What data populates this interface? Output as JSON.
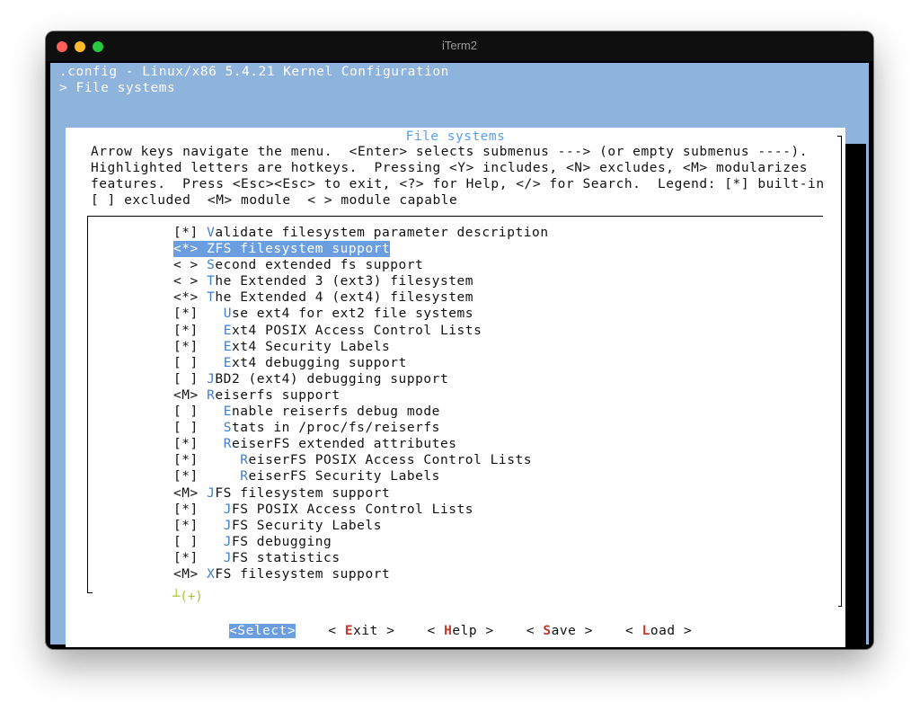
{
  "window": {
    "title": "iTerm2"
  },
  "header": {
    "config_line": ".config - Linux/x86 5.4.21 Kernel Configuration",
    "breadcrumb": "> File systems"
  },
  "dialog": {
    "title": "File systems",
    "help_lines": [
      "Arrow keys navigate the menu.  <Enter> selects submenus ---> (or empty submenus ----).",
      "Highlighted letters are hotkeys.  Pressing <Y> includes, <N> excludes, <M> modularizes",
      "features.  Press <Esc><Esc> to exit, <?> for Help, </> for Search.  Legend: [*] built-in",
      "[ ] excluded  <M> module  < > module capable"
    ],
    "more_indicator": "┴(+)"
  },
  "menu": {
    "items": [
      {
        "state": "[*]",
        "indent": " ",
        "hotkey": "V",
        "rest": "alidate filesystem parameter description"
      },
      {
        "state": "<*>",
        "indent": " ",
        "hotkey": "Z",
        "rest": "FS filesystem support",
        "selected": true
      },
      {
        "state": "< >",
        "indent": " ",
        "hotkey": "S",
        "rest": "econd extended fs support"
      },
      {
        "state": "< >",
        "indent": " ",
        "hotkey": "T",
        "rest": "he Extended 3 (ext3) filesystem"
      },
      {
        "state": "<*>",
        "indent": " ",
        "hotkey": "T",
        "rest": "he Extended 4 (ext4) filesystem"
      },
      {
        "state": "[*]",
        "indent": "   ",
        "hotkey": "U",
        "rest": "se ext4 for ext2 file systems"
      },
      {
        "state": "[*]",
        "indent": "   ",
        "hotkey": "E",
        "rest": "xt4 POSIX Access Control Lists"
      },
      {
        "state": "[*]",
        "indent": "   ",
        "hotkey": "E",
        "rest": "xt4 Security Labels"
      },
      {
        "state": "[ ]",
        "indent": "   ",
        "hotkey": "E",
        "rest": "xt4 debugging support"
      },
      {
        "state": "[ ]",
        "indent": " ",
        "hotkey": "J",
        "rest": "BD2 (ext4) debugging support"
      },
      {
        "state": "<M>",
        "indent": " ",
        "hotkey": "R",
        "rest": "eiserfs support"
      },
      {
        "state": "[ ]",
        "indent": "   ",
        "hotkey": "E",
        "rest": "nable reiserfs debug mode"
      },
      {
        "state": "[ ]",
        "indent": "   ",
        "hotkey": "S",
        "rest": "tats in /proc/fs/reiserfs"
      },
      {
        "state": "[*]",
        "indent": "   ",
        "hotkey": "R",
        "rest": "eiserFS extended attributes"
      },
      {
        "state": "[*]",
        "indent": "     ",
        "hotkey": "R",
        "rest": "eiserFS POSIX Access Control Lists"
      },
      {
        "state": "[*]",
        "indent": "     ",
        "hotkey": "R",
        "rest": "eiserFS Security Labels"
      },
      {
        "state": "<M>",
        "indent": " ",
        "hotkey": "J",
        "rest": "FS filesystem support"
      },
      {
        "state": "[*]",
        "indent": "   ",
        "hotkey": "J",
        "rest": "FS POSIX Access Control Lists"
      },
      {
        "state": "[*]",
        "indent": "   ",
        "hotkey": "J",
        "rest": "FS Security Labels"
      },
      {
        "state": "[ ]",
        "indent": "   ",
        "hotkey": "J",
        "rest": "FS debugging"
      },
      {
        "state": "[*]",
        "indent": "   ",
        "hotkey": "J",
        "rest": "FS statistics"
      },
      {
        "state": "<M>",
        "indent": " ",
        "hotkey": "X",
        "rest": "FS filesystem support"
      }
    ]
  },
  "buttons": [
    {
      "name": "select",
      "pre": "<",
      "hotkey": "S",
      "rest": "elect>",
      "selected": true
    },
    {
      "name": "exit",
      "pre": "< ",
      "hotkey": "E",
      "rest": "xit >"
    },
    {
      "name": "help",
      "pre": "< ",
      "hotkey": "H",
      "rest": "elp >"
    },
    {
      "name": "save",
      "pre": "< ",
      "hotkey": "S",
      "rest": "ave >"
    },
    {
      "name": "load",
      "pre": "< ",
      "hotkey": "L",
      "rest": "oad >"
    }
  ],
  "colors": {
    "terminal_bg": "#8eb3dd",
    "selection": "#6b9ee0",
    "hotkey_menu": "#3f7fd0",
    "hotkey_button": "#c0392b",
    "title": "#5aa0e6"
  }
}
